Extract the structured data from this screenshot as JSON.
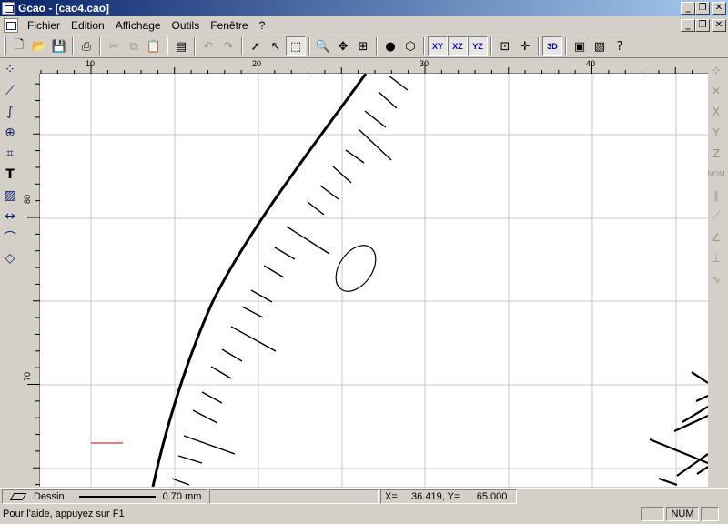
{
  "window": {
    "title": "Gcao - [cao4.cao]"
  },
  "window_buttons": {
    "minimize": "_",
    "restore": "❐",
    "close": "✕"
  },
  "menu": {
    "items": [
      "Fichier",
      "Edition",
      "Affichage",
      "Outils",
      "Fenêtre",
      "?"
    ]
  },
  "toolbar": {
    "buttons": [
      {
        "icon": "new-file-icon",
        "glyph": "🗋"
      },
      {
        "icon": "open-folder-icon",
        "glyph": "📂"
      },
      {
        "icon": "save-icon",
        "glyph": "💾"
      },
      {
        "icon": "print-icon",
        "glyph": "⎙"
      },
      {
        "icon": "cut-icon",
        "glyph": "✂"
      },
      {
        "icon": "copy-icon",
        "glyph": "⧉"
      },
      {
        "icon": "paste-icon",
        "glyph": "📋"
      },
      {
        "icon": "properties-icon",
        "glyph": "▤"
      },
      {
        "icon": "undo-icon",
        "glyph": "↶"
      },
      {
        "icon": "redo-icon",
        "glyph": "↷"
      },
      {
        "icon": "select-arrow-icon",
        "glyph": "➚"
      },
      {
        "icon": "select-trim-icon",
        "glyph": "↖"
      },
      {
        "icon": "zoom-window-icon",
        "glyph": "⬚"
      },
      {
        "icon": "zoom-in-icon",
        "glyph": "🔍"
      },
      {
        "icon": "zoom-pan-icon",
        "glyph": "✥"
      },
      {
        "icon": "zoom-all-icon",
        "glyph": "⊞"
      },
      {
        "icon": "globe-icon",
        "glyph": "●"
      },
      {
        "icon": "cube-icon",
        "glyph": "⬡"
      },
      {
        "icon": "view-xy-icon",
        "label": "XY"
      },
      {
        "icon": "view-xz-icon",
        "label": "XZ"
      },
      {
        "icon": "view-yz-icon",
        "label": "YZ"
      },
      {
        "icon": "snap-grid-icon",
        "glyph": "⊡"
      },
      {
        "icon": "snap-point-icon",
        "glyph": "✛"
      },
      {
        "icon": "view-3d-icon",
        "label": "3D"
      },
      {
        "icon": "projection-icon",
        "glyph": "▣"
      },
      {
        "icon": "projection-3d-icon",
        "glyph": "▧"
      },
      {
        "icon": "help-pointer-icon",
        "glyph": "?"
      }
    ],
    "colors": {
      "view3d": "#0000c0",
      "axis": "#0000c0"
    }
  },
  "left_tools": [
    {
      "icon": "points-icon",
      "glyph": "⁘"
    },
    {
      "icon": "polyline-icon",
      "glyph": "⟋"
    },
    {
      "icon": "curve-icon",
      "glyph": "∫"
    },
    {
      "icon": "circle-center-icon",
      "glyph": "⊕"
    },
    {
      "icon": "rectangle-icon",
      "glyph": "⌗"
    },
    {
      "icon": "text-icon",
      "glyph": "T"
    },
    {
      "icon": "hatch-icon",
      "glyph": "▨"
    },
    {
      "icon": "dimension-icon",
      "glyph": "↔"
    },
    {
      "icon": "fillet-icon",
      "glyph": "⌒"
    },
    {
      "icon": "erase-icon",
      "glyph": "◇"
    }
  ],
  "right_tools": [
    {
      "icon": "snap-end-icon",
      "glyph": "⊹"
    },
    {
      "icon": "snap-intersection-icon",
      "glyph": "✕"
    },
    {
      "icon": "snap-x-icon",
      "glyph": "X"
    },
    {
      "icon": "snap-y-icon",
      "glyph": "Y"
    },
    {
      "icon": "snap-z-icon",
      "glyph": "Z"
    },
    {
      "icon": "snap-normal-icon",
      "label": "NOM"
    },
    {
      "icon": "parallel-icon",
      "glyph": "∥"
    },
    {
      "icon": "tangent-icon",
      "glyph": "⟋"
    },
    {
      "icon": "angle-icon",
      "glyph": "∠"
    },
    {
      "icon": "perpendicular-icon",
      "glyph": "⊥"
    },
    {
      "icon": "spline-icon",
      "glyph": "∿"
    }
  ],
  "rulers": {
    "horizontal_labels": [
      "10",
      "20",
      "30",
      "40"
    ],
    "vertical_labels": [
      "80",
      "70"
    ]
  },
  "status": {
    "layer": "Dessin",
    "line_width": "0.70 mm",
    "coords": "X=     36.419, Y=      65.000",
    "help": "Pour l'aide, appuyez sur F1",
    "num": "NUM"
  }
}
